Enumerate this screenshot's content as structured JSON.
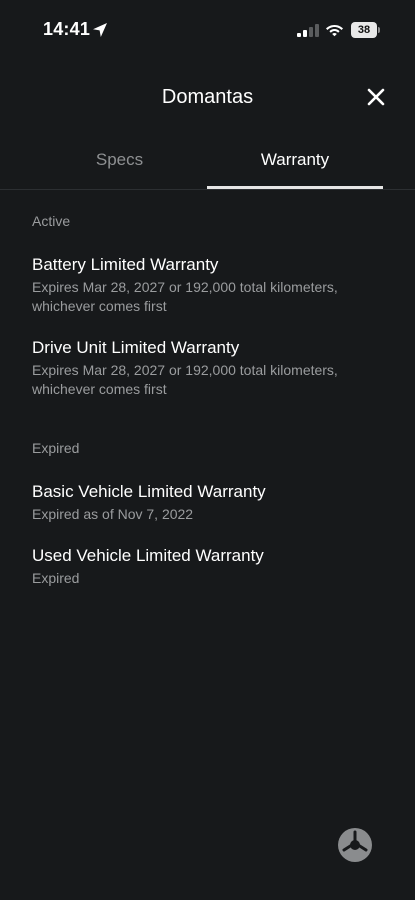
{
  "status_bar": {
    "time": "14:41",
    "battery_level": "38"
  },
  "header": {
    "title": "Domantas"
  },
  "tabs": [
    {
      "label": "Specs",
      "selected": false
    },
    {
      "label": "Warranty",
      "selected": true
    }
  ],
  "sections": {
    "active": {
      "label": "Active",
      "items": [
        {
          "title": "Battery Limited Warranty",
          "subtitle": "Expires Mar 28, 2027 or 192,000 total kilometers, whichever comes first"
        },
        {
          "title": "Drive Unit Limited Warranty",
          "subtitle": "Expires Mar 28, 2027 or 192,000 total kilometers, whichever comes first"
        }
      ]
    },
    "expired": {
      "label": "Expired",
      "items": [
        {
          "title": "Basic Vehicle Limited Warranty",
          "subtitle": "Expired as of Nov 7, 2022"
        },
        {
          "title": "Used Vehicle Limited Warranty",
          "subtitle": "Expired"
        }
      ]
    }
  },
  "icons": {
    "location": "location-arrow-icon",
    "signal": "cellular-signal-icon",
    "wifi": "wifi-icon",
    "close": "close-icon",
    "fab": "app-logo-icon"
  },
  "colors": {
    "background": "#17191b",
    "primary_text": "#ffffff",
    "secondary_text": "#9a9c9e",
    "divider": "#2c2f32"
  }
}
